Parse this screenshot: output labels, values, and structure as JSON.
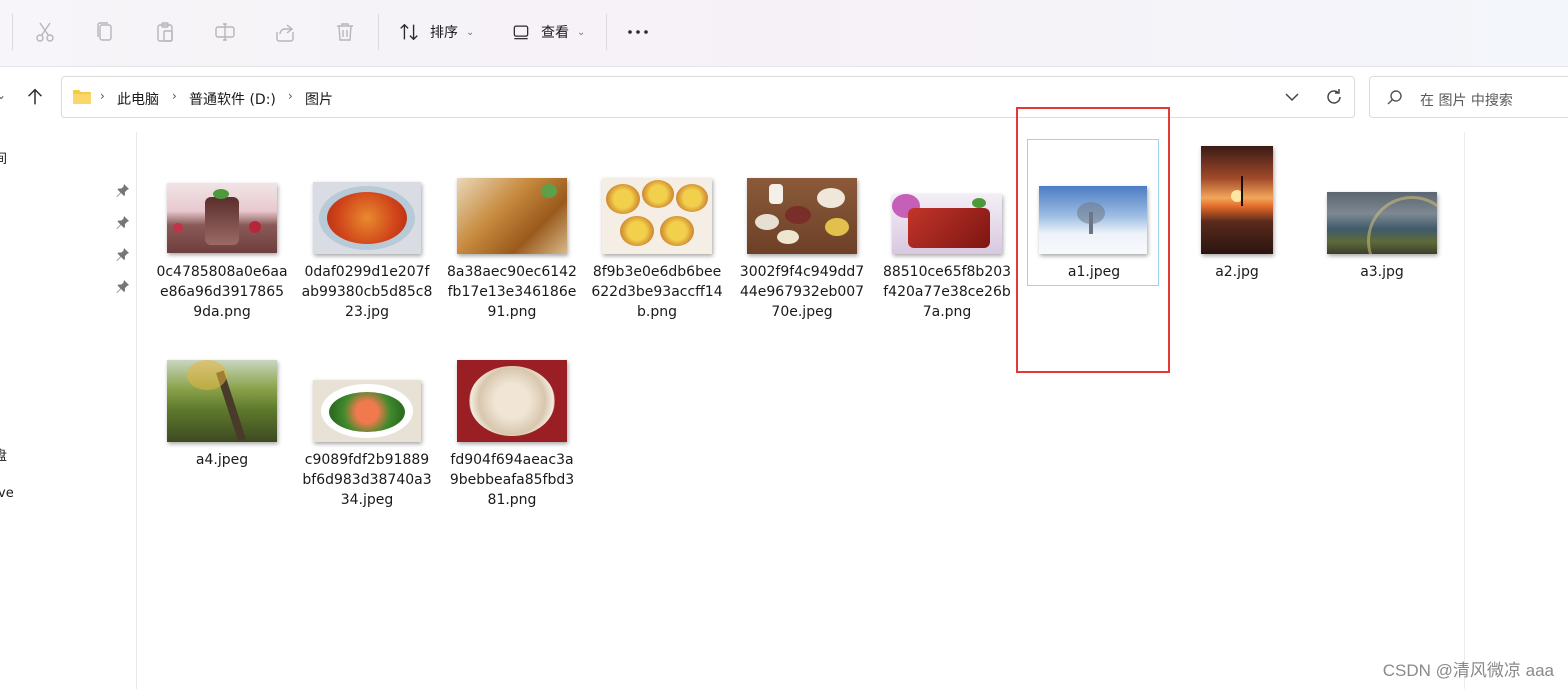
{
  "toolbar": {
    "sort_label": "排序",
    "view_label": "查看"
  },
  "address": {
    "crumbs": [
      "此电脑",
      "普通软件 (D:)",
      "图片"
    ]
  },
  "search": {
    "placeholder": "在 图片 中搜索"
  },
  "sidebar": {
    "fragments": [
      "间",
      "盘",
      "ve"
    ]
  },
  "files": [
    {
      "name": "0c4785808a0e6aae86a96d39178659da.png",
      "thumb": "dessert-cake"
    },
    {
      "name": "0daf0299d1e207fab99380cb5d85c823.jpg",
      "thumb": "mapo-tofu"
    },
    {
      "name": "8a38aec90ec6142fb17e13e346186e91.png",
      "thumb": "roast-duck"
    },
    {
      "name": "8f9b3e0e6db6bee622d3be93accff14b.png",
      "thumb": "egg-tarts"
    },
    {
      "name": "3002f9f4c949dd744e967932eb00770e.jpeg",
      "thumb": "ingredients"
    },
    {
      "name": "88510ce65f8b203f420a77e38ce26b7a.png",
      "thumb": "braised-pork"
    },
    {
      "name": "a1.jpeg",
      "thumb": "snow-tree",
      "selected": true
    },
    {
      "name": "a2.jpg",
      "thumb": "sunset-sea"
    },
    {
      "name": "a3.jpg",
      "thumb": "rainbow"
    },
    {
      "name": "a4.jpeg",
      "thumb": "forest"
    },
    {
      "name": "c9089fdf2b91889bf6d983d38740a334.jpeg",
      "thumb": "shrimp-broccoli"
    },
    {
      "name": "fd904f694aeac3a9bebbeafa85fbd381.png",
      "thumb": "dumplings"
    }
  ],
  "watermark": "CSDN @清风微凉 aaa",
  "colors": {
    "selection_border": "#9ed3ea",
    "annotation_red": "#e53935"
  }
}
